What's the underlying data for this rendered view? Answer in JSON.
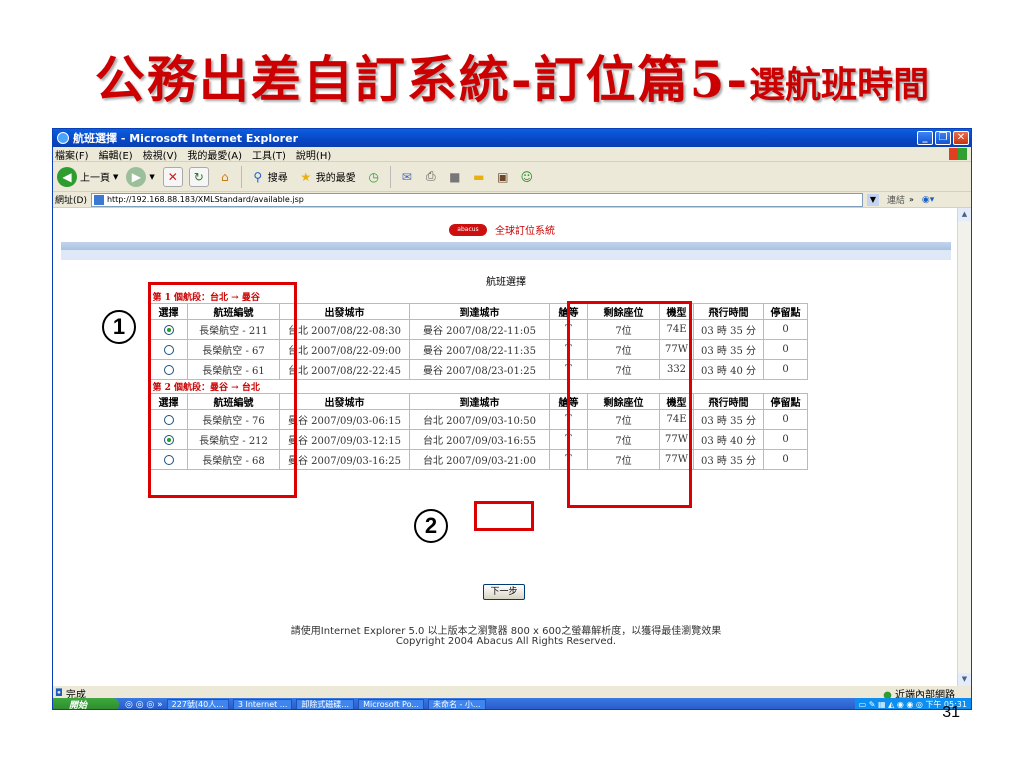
{
  "slide": {
    "title_main": "公務出差自訂系統-訂位篇5-",
    "title_sub": "選航班時間",
    "page_number": "31",
    "callouts": [
      "1",
      "2"
    ]
  },
  "window": {
    "title": "航班選擇 - Microsoft Internet Explorer",
    "menu": [
      "檔案(F)",
      "編輯(E)",
      "檢視(V)",
      "我的最愛(A)",
      "工具(T)",
      "說明(H)"
    ],
    "toolbar": {
      "back": "上一頁",
      "search": "搜尋",
      "favorites": "我的最愛"
    },
    "address_label": "網址(D)",
    "address": "http://192.168.88.183/XMLStandard/available.jsp",
    "links_label": "連結",
    "status": "完成",
    "zone": "近端內部網路"
  },
  "taskbar": {
    "start": "開始",
    "items": [
      "227號(40人...",
      "3 Internet ...",
      "卸除式磁碟...",
      "Microsoft Po...",
      "未命名 - 小..."
    ],
    "clock": "下午 05:31"
  },
  "page": {
    "brand": "abacus",
    "system_name": "全球訂位系統",
    "heading": "航班選擇",
    "columns": [
      "選擇",
      "航班編號",
      "出發城市",
      "到達城市",
      "艙等",
      "剩餘座位",
      "機型",
      "飛行時間",
      "停留點"
    ],
    "segments": [
      {
        "label": "第 1 個航段：台北 → 曼谷",
        "rows": [
          {
            "selected": true,
            "flight": "長榮航空 - 211",
            "depart": "台北 2007/08/22-08:30",
            "arrive": "曼谷 2007/08/22-11:05",
            "class": "T",
            "seats": "7位",
            "model": "74E",
            "duration": "03 時 35 分",
            "stops": "0"
          },
          {
            "selected": false,
            "flight": "長榮航空 - 67",
            "depart": "台北 2007/08/22-09:00",
            "arrive": "曼谷 2007/08/22-11:35",
            "class": "T",
            "seats": "7位",
            "model": "77W",
            "duration": "03 時 35 分",
            "stops": "0"
          },
          {
            "selected": false,
            "flight": "長榮航空 - 61",
            "depart": "台北 2007/08/22-22:45",
            "arrive": "曼谷 2007/08/23-01:25",
            "class": "T",
            "seats": "7位",
            "model": "332",
            "duration": "03 時 40 分",
            "stops": "0"
          }
        ]
      },
      {
        "label": "第 2 個航段：曼谷 → 台北",
        "rows": [
          {
            "selected": false,
            "flight": "長榮航空 - 76",
            "depart": "曼谷 2007/09/03-06:15",
            "arrive": "台北 2007/09/03-10:50",
            "class": "T",
            "seats": "7位",
            "model": "74E",
            "duration": "03 時 35 分",
            "stops": "0"
          },
          {
            "selected": true,
            "flight": "長榮航空 - 212",
            "depart": "曼谷 2007/09/03-12:15",
            "arrive": "台北 2007/09/03-16:55",
            "class": "T",
            "seats": "7位",
            "model": "77W",
            "duration": "03 時 40 分",
            "stops": "0"
          },
          {
            "selected": false,
            "flight": "長榮航空 - 68",
            "depart": "曼谷 2007/09/03-16:25",
            "arrive": "台北 2007/09/03-21:00",
            "class": "T",
            "seats": "7位",
            "model": "77W",
            "duration": "03 時 35 分",
            "stops": "0"
          }
        ]
      }
    ],
    "next_button": "下一步",
    "footer_note": "請使用Internet Explorer 5.0 以上版本之瀏覽器 800 x 600之螢幕解析度，以獲得最佳瀏覽效果",
    "copyright": "Copyright 2004 Abacus All Rights Reserved."
  }
}
